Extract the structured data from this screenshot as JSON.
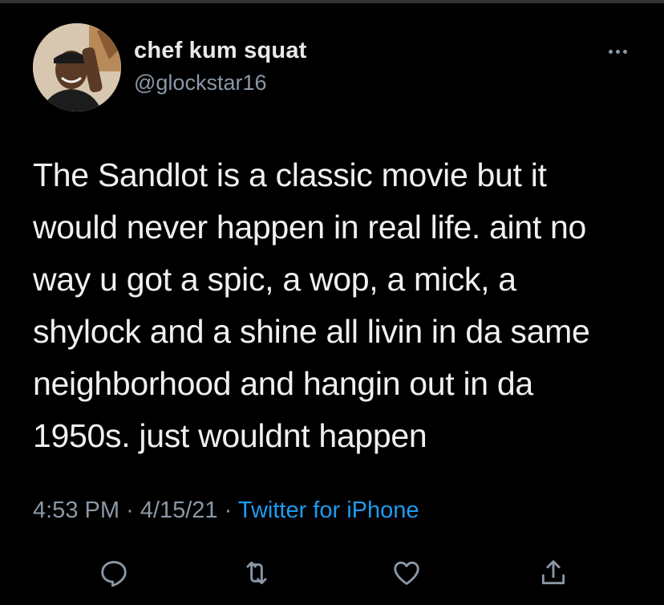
{
  "tweet": {
    "display_name": "chef kum squat",
    "handle": "@glockstar16",
    "text_lines": [
      "The Sandlot is a classic movie but it",
      "would never happen in real life. aint no",
      "way u got a spic, a wop, a mick, a",
      "shylock and a shine all livin in da same",
      "neighborhood and hangin out in da",
      "1950s. just wouldnt happen"
    ],
    "time": "4:53 PM",
    "date": "4/15/21",
    "separator": "·",
    "source": "Twitter for iPhone"
  },
  "icons": {
    "more": "more-options-icon",
    "reply": "reply-icon",
    "retweet": "retweet-icon",
    "like": "heart-icon",
    "share": "share-icon"
  },
  "colors": {
    "background": "#000000",
    "text": "#e7e9ea",
    "secondary": "#8b98a5",
    "link": "#1d9bf0"
  }
}
